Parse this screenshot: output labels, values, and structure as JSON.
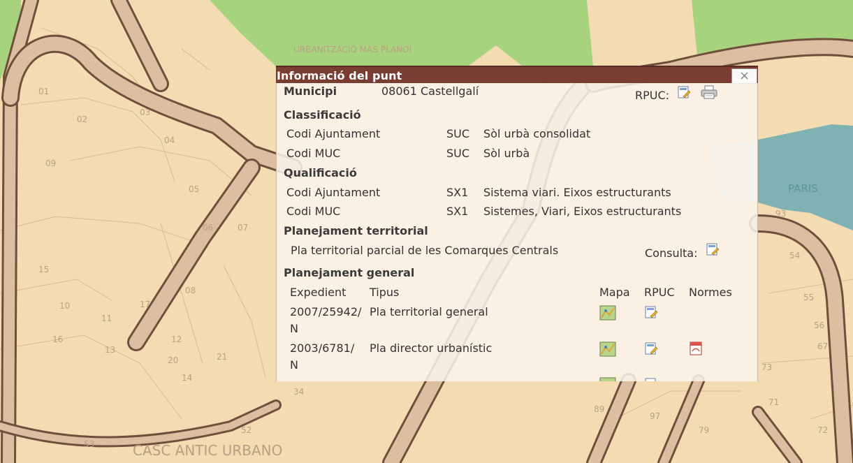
{
  "map": {
    "area_label": "URBANITZACIÓ MAS PLANOI",
    "bottom_label": "CASC ANTIC URBANO",
    "right_label": "PARIS",
    "parcel_numbers": [
      "01",
      "02",
      "03",
      "04",
      "05",
      "06",
      "07",
      "08",
      "09",
      "10",
      "11",
      "12",
      "13",
      "14",
      "15",
      "16",
      "17",
      "20",
      "21",
      "34",
      "52",
      "53",
      "54",
      "55",
      "56",
      "67",
      "71",
      "72",
      "73",
      "79",
      "89",
      "97",
      "93"
    ]
  },
  "popup": {
    "title": "Informació del punt",
    "close_label": "×",
    "municipi": {
      "label": "Municipi",
      "value": "08061 Castellgalí",
      "rpuc_label": "RPUC:"
    },
    "classificacio": {
      "heading": "Classificació",
      "rows": [
        {
          "label": "Codi Ajuntament",
          "code": "SUC",
          "desc": "Sòl urbà consolidat"
        },
        {
          "label": "Codi MUC",
          "code": "SUC",
          "desc": "Sòl urbà"
        }
      ]
    },
    "qualificacio": {
      "heading": "Qualificació",
      "rows": [
        {
          "label": "Codi Ajuntament",
          "code": "SX1",
          "desc": "Sistema viari. Eixos estructurants"
        },
        {
          "label": "Codi MUC",
          "code": "SX1",
          "desc": "Sistemes, Viari, Eixos estructurants"
        }
      ]
    },
    "territorial": {
      "heading": "Planejament territorial",
      "plan": "Pla territorial parcial de les Comarques Centrals",
      "consulta_label": "Consulta:"
    },
    "general": {
      "heading": "Planejament general",
      "columns": {
        "expedient": "Expedient",
        "tipus": "Tipus",
        "mapa": "Mapa",
        "rpuc": "RPUC",
        "normes": "Normes"
      },
      "rows": [
        {
          "exp_line1": "2007/25942/",
          "exp_line2": "N",
          "tipus": "Pla territorial general"
        },
        {
          "exp_line1": "2003/6781/",
          "exp_line2": "N",
          "tipus": "Pla director urbanístic"
        }
      ]
    }
  },
  "colors": {
    "header": "#7a3d33",
    "parcel": "#f3dcb2",
    "green_zone": "#a8d37e",
    "water_zone": "#7fb3b3",
    "road_fill": "#dcbfa0",
    "road_edge": "#6e4f3c"
  }
}
